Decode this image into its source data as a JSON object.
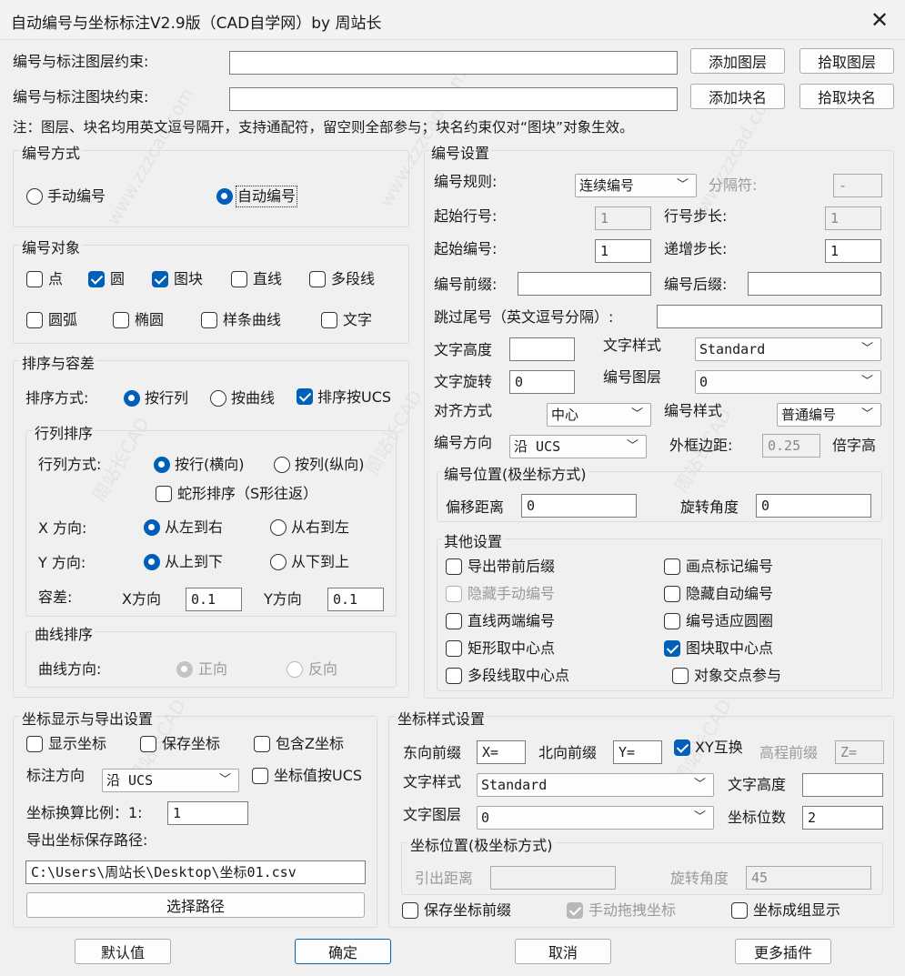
{
  "window": {
    "title": "自动编号与坐标标注V2.9版（CAD自学网）by 周站长",
    "close": "✕"
  },
  "constraints": {
    "layer_label": "编号与标注图层约束:",
    "layer_value": "",
    "add_layer": "添加图层",
    "pick_layer": "拾取图层",
    "block_label": "编号与标注图块约束:",
    "block_value": "",
    "add_block": "添加块名",
    "pick_block": "拾取块名",
    "note": "注：图层、块名均用英文逗号隔开，支持通配符，留空则全部参与；块名约束仅对“图块”对象生效。"
  },
  "numbering_mode": {
    "title": "编号方式",
    "manual": "手动编号",
    "auto": "自动编号",
    "selected": "auto"
  },
  "numbering_objects": {
    "title": "编号对象",
    "items": [
      {
        "label": "点",
        "checked": false
      },
      {
        "label": "圆",
        "checked": true
      },
      {
        "label": "图块",
        "checked": true
      },
      {
        "label": "直线",
        "checked": false
      },
      {
        "label": "多段线",
        "checked": false
      },
      {
        "label": "圆弧",
        "checked": false
      },
      {
        "label": "椭圆",
        "checked": false
      },
      {
        "label": "样条曲线",
        "checked": false
      },
      {
        "label": "文字",
        "checked": false
      }
    ]
  },
  "sort": {
    "title": "排序与容差",
    "method_label": "排序方式:",
    "by_row": "按行列",
    "by_curve": "按曲线",
    "by_ucs": "排序按UCS",
    "by_ucs_checked": true,
    "row_group": {
      "title": "行列排序",
      "mode_label": "行列方式:",
      "row": "按行(横向)",
      "col": "按列(纵向)",
      "snake": "蛇形排序（S形往返）",
      "x_label": "X 方向:",
      "x_lr": "从左到右",
      "x_rl": "从右到左",
      "y_label": "Y 方向:",
      "y_tb": "从上到下",
      "y_bt": "从下到上",
      "tol_label": "容差:",
      "tol_x_label": "X方向",
      "tol_x": "0.1",
      "tol_y_label": "Y方向",
      "tol_y": "0.1"
    },
    "curve_group": {
      "title": "曲线排序",
      "dir_label": "曲线方向:",
      "forward": "正向",
      "reverse": "反向"
    }
  },
  "num_settings": {
    "title": "编号设置",
    "rule_label": "编号规则:",
    "rule_value": "连续编号",
    "sep_label": "分隔符:",
    "sep_value": "-",
    "start_row_label": "起始行号:",
    "start_row": "1",
    "row_step_label": "行号步长:",
    "row_step": "1",
    "start_num_label": "起始编号:",
    "start_num": "1",
    "inc_label": "递增步长:",
    "inc": "1",
    "prefix_label": "编号前缀:",
    "prefix": "",
    "suffix_label": "编号后缀:",
    "suffix": "",
    "skip_label": "跳过尾号（英文逗号分隔）:",
    "skip": "",
    "text_height_label": "文字高度",
    "text_height": "",
    "text_style_label": "文字样式",
    "text_style": "Standard",
    "text_rot_label": "文字旋转",
    "text_rot": "0",
    "num_layer_label": "编号图层",
    "num_layer": "0",
    "align_label": "对齐方式",
    "align": "中心",
    "num_style_label": "编号样式",
    "num_style": "普通编号",
    "num_dir_label": "编号方向",
    "num_dir": "沿 UCS",
    "frame_label": "外框边距:",
    "frame": "0.25",
    "frame_unit": "倍字高",
    "pos_group": {
      "title": "编号位置(极坐标方式)",
      "offset_label": "偏移距离",
      "offset": "0",
      "angle_label": "旋转角度",
      "angle": "0"
    },
    "other_group": {
      "title": "其他设置",
      "items": [
        {
          "label": "导出带前后缀",
          "checked": false,
          "disabled": false
        },
        {
          "label": "画点标记编号",
          "checked": false,
          "disabled": false
        },
        {
          "label": "隐藏手动编号",
          "checked": false,
          "disabled": true
        },
        {
          "label": "隐藏自动编号",
          "checked": false,
          "disabled": false
        },
        {
          "label": "直线两端编号",
          "checked": false,
          "disabled": false
        },
        {
          "label": "编号适应圆圈",
          "checked": false,
          "disabled": false
        },
        {
          "label": "矩形取中心点",
          "checked": false,
          "disabled": false
        },
        {
          "label": "图块取中心点",
          "checked": true,
          "disabled": false
        },
        {
          "label": "多段线取中心点",
          "checked": false,
          "disabled": false
        },
        {
          "label": "对象交点参与",
          "checked": false,
          "disabled": false
        }
      ]
    }
  },
  "coord_export": {
    "title": "坐标显示与导出设置",
    "show": "显示坐标",
    "save": "保存坐标",
    "incl_z": "包含Z坐标",
    "dir_label": "标注方向",
    "dir_value": "沿 UCS",
    "by_ucs": "坐标值按UCS",
    "scale_label": "坐标换算比例：1:",
    "scale": "1",
    "path_label": "导出坐标保存路径:",
    "path": "C:\\Users\\周站长\\Desktop\\坐标01.csv",
    "choose_path": "选择路径"
  },
  "coord_style": {
    "title": "坐标样式设置",
    "east_label": "东向前缀",
    "east": "X=",
    "north_label": "北向前缀",
    "north": "Y=",
    "xy_swap": "XY互换",
    "xy_swap_checked": true,
    "elev_label": "高程前缀",
    "elev": "Z=",
    "text_style_label": "文字样式",
    "text_style": "Standard",
    "text_height_label": "文字高度",
    "text_height": "",
    "text_layer_label": "文字图层",
    "text_layer": "0",
    "digits_label": "坐标位数",
    "digits": "2",
    "pos_group": {
      "title": "坐标位置(极坐标方式)",
      "lead_label": "引出距离",
      "lead": "",
      "angle_label": "旋转角度",
      "angle": "45"
    },
    "save_prefix": "保存坐标前缀",
    "manual_drag": "手动拖拽坐标",
    "group_show": "坐标成组显示"
  },
  "footer": {
    "default": "默认值",
    "ok": "确定",
    "cancel": "取消",
    "more": "更多插件"
  },
  "watermarks": [
    "周站长CAD",
    "www.zzzcad.com"
  ]
}
